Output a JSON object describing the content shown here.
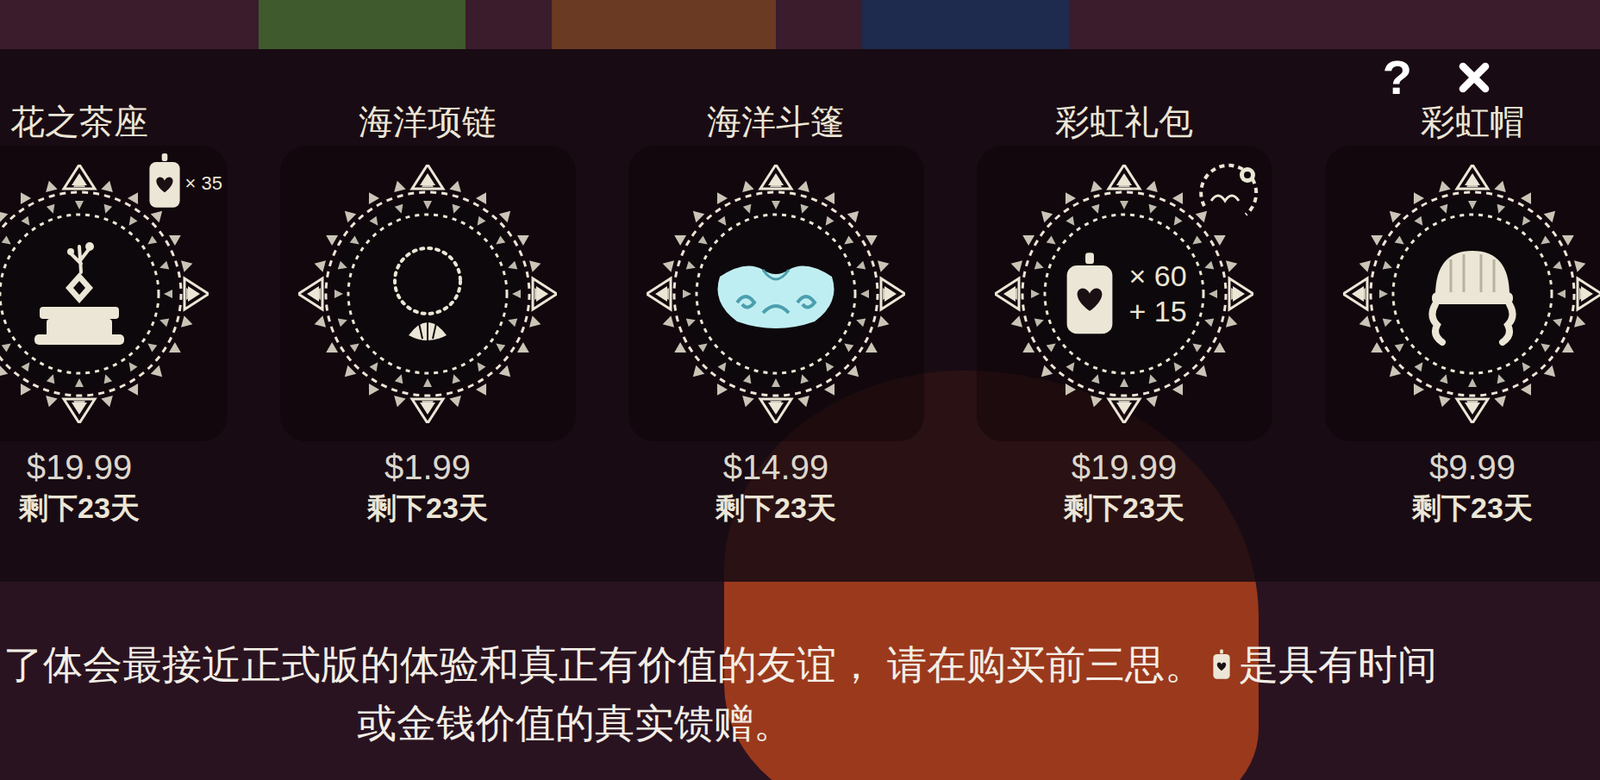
{
  "shop": {
    "items": [
      {
        "name": "花之茶座",
        "price": "$19.99",
        "remaining": "剩下23天",
        "kind": "tea-table",
        "badge": "candles",
        "badge_count": "× 35",
        "contents": []
      },
      {
        "name": "海洋项链",
        "price": "$1.99",
        "remaining": "剩下23天",
        "kind": "necklace",
        "badge": "none",
        "badge_count": "",
        "contents": []
      },
      {
        "name": "海洋斗篷",
        "price": "$14.99",
        "remaining": "剩下23天",
        "kind": "cape",
        "badge": "none",
        "badge_count": "",
        "contents": []
      },
      {
        "name": "彩虹礼包",
        "price": "$19.99",
        "remaining": "剩下23天",
        "kind": "candle-pack",
        "badge": "friendship",
        "badge_count": "",
        "contents": [
          "× 60",
          "+ 15"
        ]
      },
      {
        "name": "彩虹帽",
        "price": "$9.99",
        "remaining": "剩下23天",
        "kind": "hat",
        "badge": "none",
        "badge_count": "",
        "contents": []
      }
    ]
  },
  "toolbar": {
    "help": "?"
  },
  "notice": {
    "line1": "了体会最接近正式版的体验和真正有价值的友谊， 请在购买前三思。",
    "line1_end": "是具有时间",
    "line2": "或金钱价值的真实馈赠。"
  }
}
